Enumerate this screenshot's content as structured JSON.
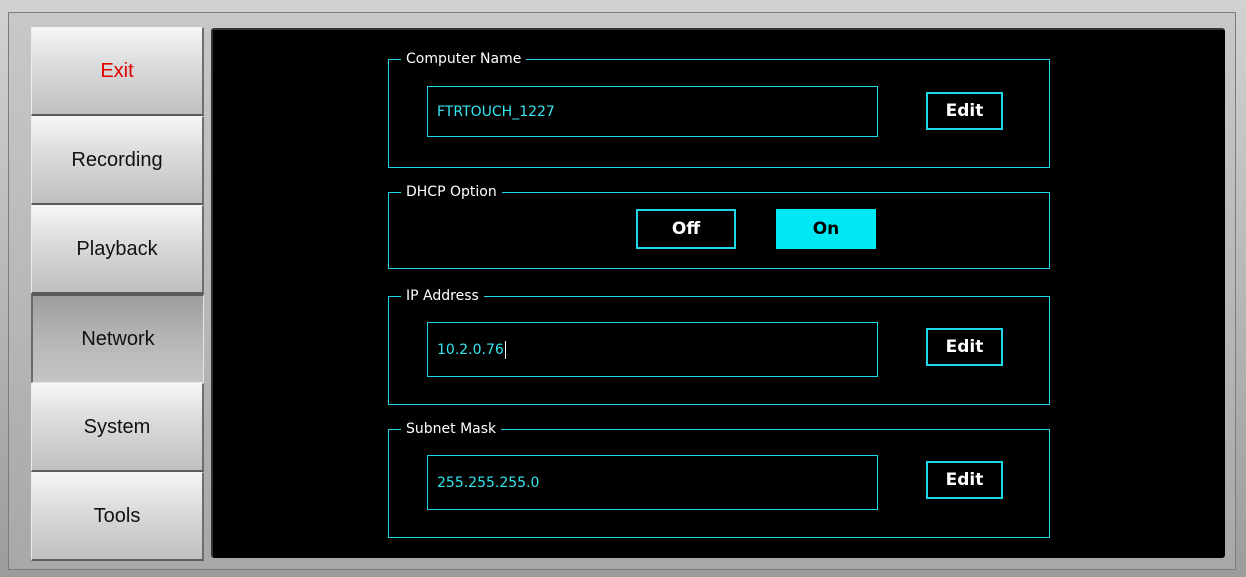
{
  "sidebar": {
    "items": [
      {
        "label": "Exit"
      },
      {
        "label": "Recording"
      },
      {
        "label": "Playback"
      },
      {
        "label": "Network"
      },
      {
        "label": "System"
      },
      {
        "label": "Tools"
      }
    ],
    "active": "Network"
  },
  "computer_name": {
    "legend": "Computer Name",
    "value": "FTRTOUCH_1227",
    "edit_label": "Edit"
  },
  "dhcp": {
    "legend": "DHCP Option",
    "off_label": "Off",
    "on_label": "On",
    "selected": "On"
  },
  "ip_address": {
    "legend": "IP Address",
    "value": "10.2.0.76",
    "edit_label": "Edit"
  },
  "subnet_mask": {
    "legend": "Subnet Mask",
    "value": "255.255.255.0",
    "edit_label": "Edit"
  },
  "colors": {
    "accent": "#1fd8e6",
    "selected_fill": "#00e8f4",
    "exit_text": "#e00000"
  }
}
